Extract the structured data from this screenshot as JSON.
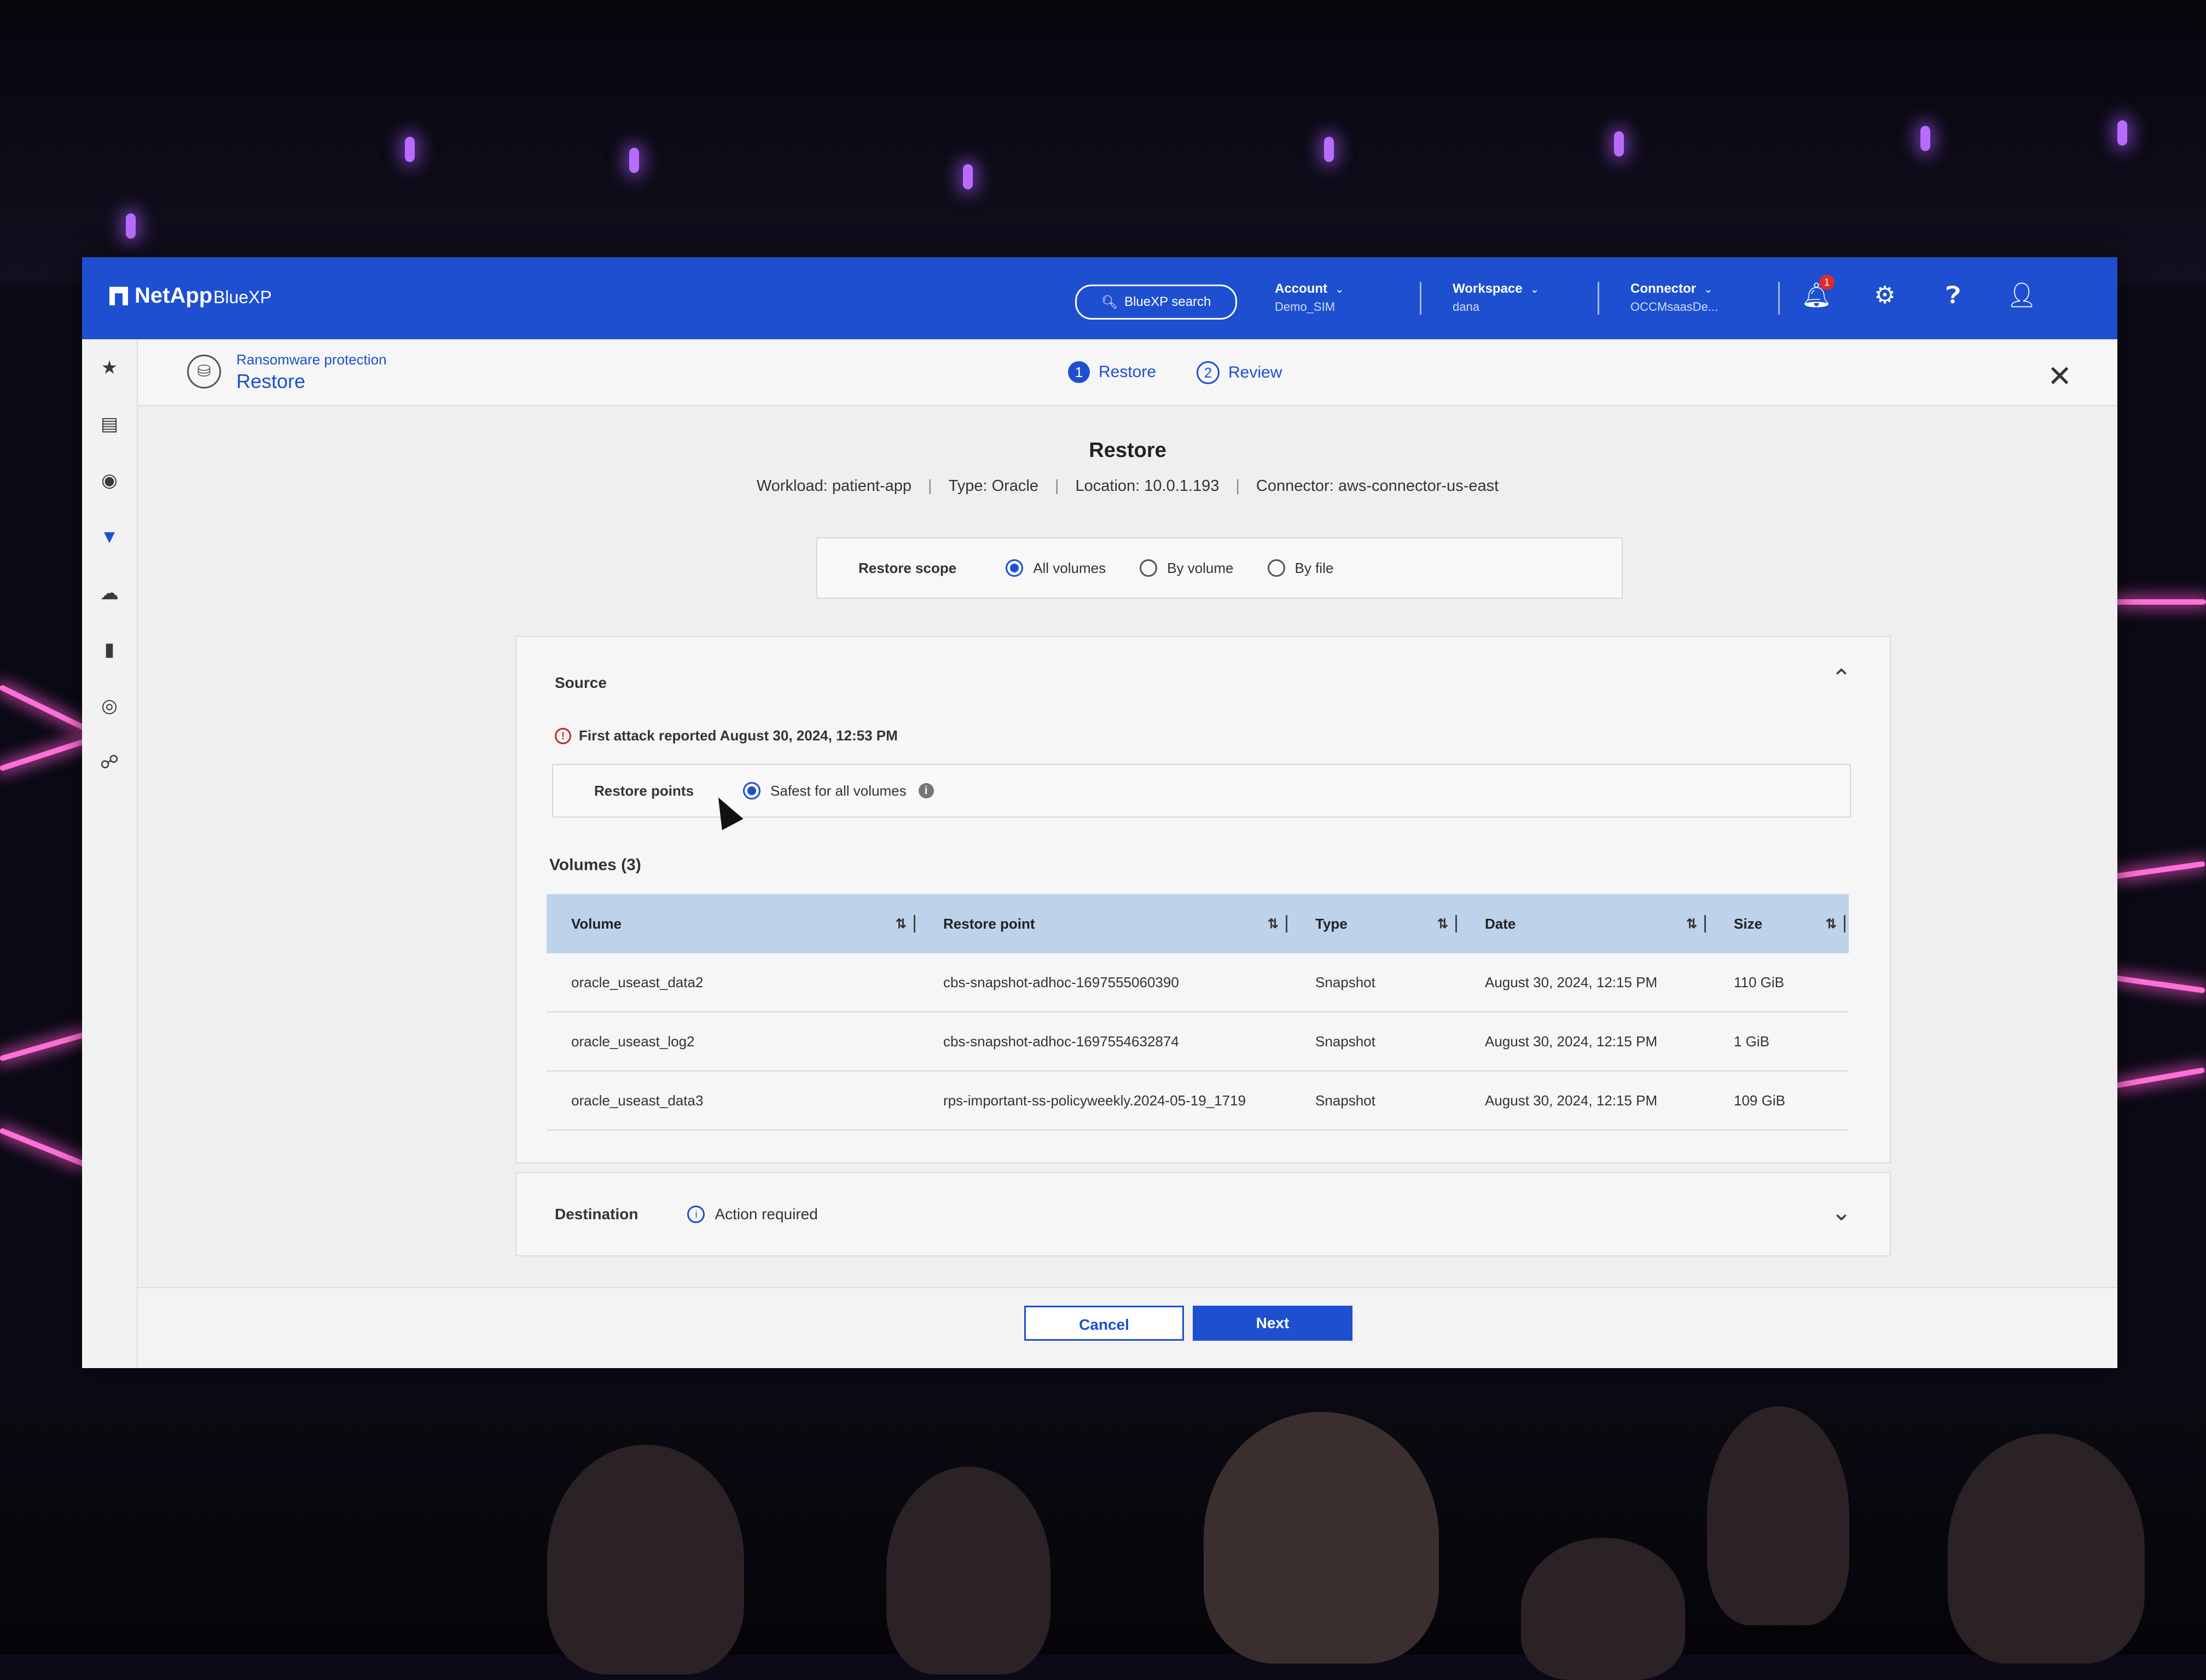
{
  "app": {
    "brand": "NetApp",
    "product": "BlueXP"
  },
  "topbar": {
    "search_label": "BlueXP search",
    "account": {
      "label": "Account",
      "value": "Demo_SIM"
    },
    "workspace": {
      "label": "Workspace",
      "value": "dana"
    },
    "connector": {
      "label": "Connector",
      "value": "OCCMsaasDe..."
    },
    "notification_count": "1"
  },
  "sidebar": {
    "items": [
      "star-icon",
      "storage-icon",
      "health-icon",
      "shield-icon",
      "backup-icon",
      "reports-icon",
      "compliance-icon",
      "share-icon"
    ],
    "active": "shield-icon"
  },
  "subheader": {
    "breadcrumb": "Ransomware protection",
    "title": "Restore",
    "steps": [
      {
        "num": "1",
        "label": "Restore"
      },
      {
        "num": "2",
        "label": "Review"
      }
    ]
  },
  "page": {
    "title": "Restore",
    "meta": {
      "workload": "Workload: patient-app",
      "type": "Type: Oracle",
      "location": "Location: 10.0.1.193",
      "connector": "Connector: aws-connector-us-east"
    }
  },
  "scope": {
    "label": "Restore scope",
    "options": [
      "All volumes",
      "By volume",
      "By file"
    ],
    "selected": "All volumes"
  },
  "source": {
    "title": "Source",
    "alert": "First attack reported August 30, 2024, 12:53 PM",
    "restore_points_label": "Restore points",
    "restore_points_option": "Safest for all volumes",
    "volumes_title": "Volumes (3)",
    "columns": [
      "Volume",
      "Restore point",
      "Type",
      "Date",
      "Size"
    ],
    "rows": [
      [
        "oracle_useast_data2",
        "cbs-snapshot-adhoc-1697555060390",
        "Snapshot",
        "August 30, 2024, 12:15 PM",
        "110 GiB"
      ],
      [
        "oracle_useast_log2",
        "cbs-snapshot-adhoc-1697554632874",
        "Snapshot",
        "August 30, 2024, 12:15 PM",
        "1 GiB"
      ],
      [
        "oracle_useast_data3",
        "rps-important-ss-policyweekly.2024-05-19_1719",
        "Snapshot",
        "August 30, 2024, 12:15 PM",
        "109 GiB"
      ]
    ]
  },
  "destination": {
    "title": "Destination",
    "status": "Action required"
  },
  "footer": {
    "cancel": "Cancel",
    "next": "Next"
  },
  "colors": {
    "accent": "#1d4fd0",
    "table_header": "#bcd3ea",
    "alert": "#c62828"
  }
}
